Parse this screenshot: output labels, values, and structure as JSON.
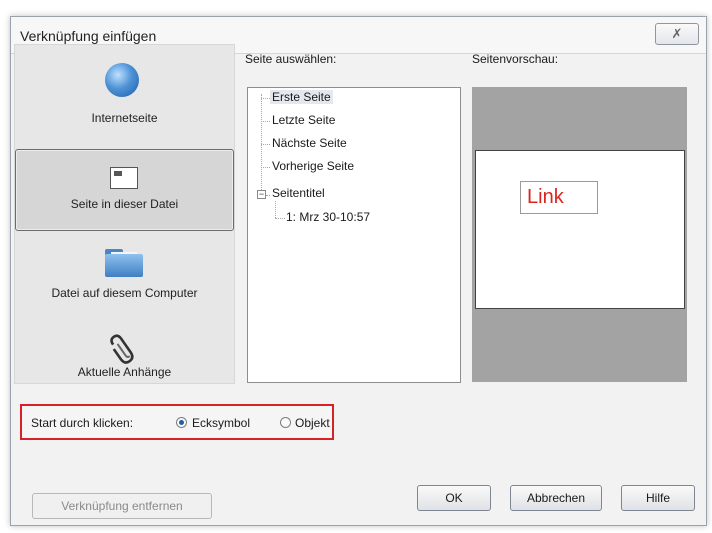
{
  "dialog": {
    "title": "Verknüpfung einfügen",
    "close_label": "✗"
  },
  "sidebar": {
    "items": [
      {
        "label": "Internetseite",
        "icon": "globe-icon"
      },
      {
        "label": "Seite in dieser Datei",
        "icon": "page-icon",
        "selected": true
      },
      {
        "label": "Datei auf diesem Computer",
        "icon": "folder-icon"
      },
      {
        "label": "Aktuelle Anhänge",
        "icon": "paperclip-icon"
      }
    ]
  },
  "page_select": {
    "label": "Seite auswählen:",
    "items": [
      "Erste Seite",
      "Letzte Seite",
      "Nächste Seite",
      "Vorherige Seite",
      "Seitentitel",
      "1: Mrz 30-10:57"
    ],
    "selected": "Erste Seite"
  },
  "preview": {
    "label": "Seitenvorschau:",
    "link_text": "Link"
  },
  "start_options": {
    "label": "Start durch klicken:",
    "options": [
      "Ecksymbol",
      "Objekt"
    ],
    "selected": "Ecksymbol"
  },
  "buttons": {
    "remove": "Verknüpfung entfernen",
    "ok": "OK",
    "cancel": "Abbrechen",
    "help": "Hilfe"
  },
  "colors": {
    "highlight_border": "#d72027",
    "link_text": "#d9261c",
    "preview_bg": "#a3a3a3"
  }
}
